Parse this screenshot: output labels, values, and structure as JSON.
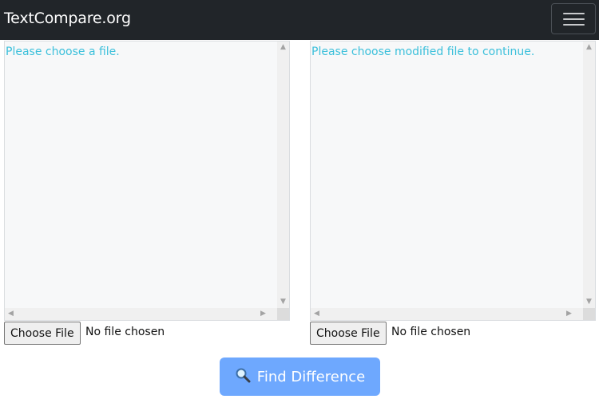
{
  "navbar": {
    "brand": "TextCompare.org",
    "menu_icon": "hamburger-menu-icon"
  },
  "left_panel": {
    "message": "Please choose a file.",
    "choose_button": "Choose File",
    "file_status": "No file chosen"
  },
  "right_panel": {
    "message": "Please choose modified file to continue.",
    "choose_button": "Choose File",
    "file_status": "No file chosen"
  },
  "action": {
    "label": "Find Difference",
    "icon": "magnifier-icon"
  },
  "colors": {
    "navbar_bg": "#212529",
    "message_text": "#3cc0db",
    "editor_bg": "#f7f8f9",
    "primary_button": "#6ea8fe"
  }
}
